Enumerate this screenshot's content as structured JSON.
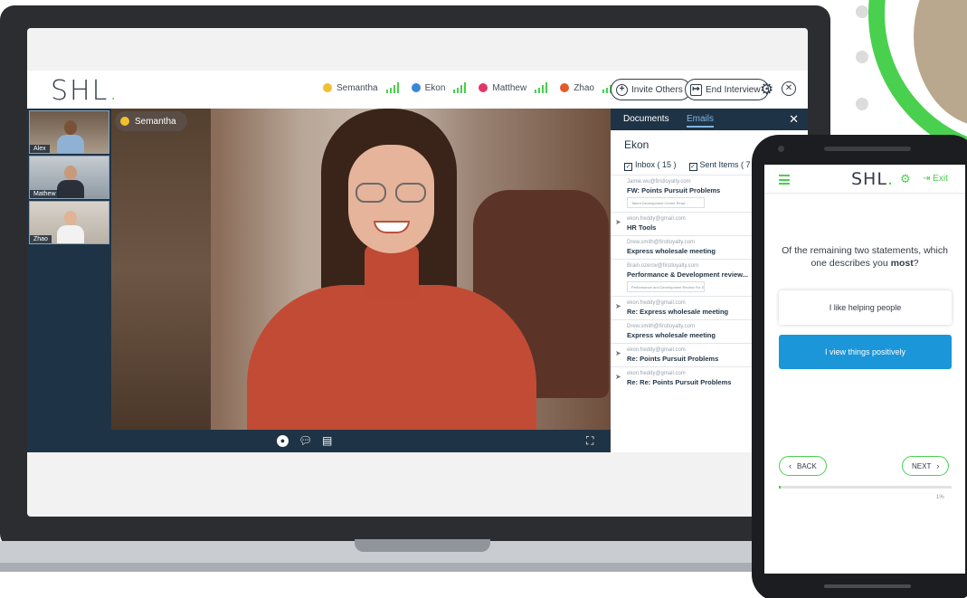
{
  "app": {
    "logo": "SHL",
    "participants": [
      {
        "name": "Semantha",
        "color": "#f0c030"
      },
      {
        "name": "Ekon",
        "color": "#3a86d8"
      },
      {
        "name": "Matthew",
        "color": "#e0386a"
      },
      {
        "name": "Zhao",
        "color": "#e55a2b"
      }
    ],
    "buttons": {
      "invite": "Invite Others",
      "end": "End Interview"
    },
    "icons": {
      "settings": "gear-icon",
      "close": "close-icon"
    }
  },
  "video": {
    "speaker": "Semantha",
    "speaker_color": "#f0c030",
    "thumbnails": [
      "Alex",
      "Mathew",
      "Zhao"
    ]
  },
  "emails": {
    "tabs": [
      "Documents",
      "Emails"
    ],
    "active_tab": "Emails",
    "owner": "Ekon",
    "folders": {
      "inbox": "Inbox ( 15 )",
      "sent": "Sent Items ( 7 )"
    },
    "items": [
      {
        "from": "Jamie.wu@firstloyalty.com",
        "subject": "FW: Points Pursuit Problems",
        "attachment": "Talent Development Centre Read...",
        "sent": false
      },
      {
        "from": "ekon.freddy@gmail.com",
        "subject": "HR Tools",
        "attachment": "",
        "sent": true
      },
      {
        "from": "Drew.smith@firstloyalty.com",
        "subject": "Express wholesale meeting",
        "attachment": "",
        "sent": false
      },
      {
        "from": "Brain.ozerov@firstloyalty.com",
        "subject": "Performance & Development review...",
        "attachment": "Performance and Development Review For E...",
        "sent": false
      },
      {
        "from": "ekon.freddy@gmail.com",
        "subject": "Re: Express wholesale meeting",
        "attachment": "",
        "sent": true
      },
      {
        "from": "Drew.smith@firstloyalty.com",
        "subject": "Express wholesale meeting",
        "attachment": "",
        "sent": false
      },
      {
        "from": "ekon.freddy@gmail.com",
        "subject": "Re: Points Pursuit Problems",
        "attachment": "",
        "sent": true
      },
      {
        "from": "ekon.freddy@gmail.com",
        "subject": "Re: Re: Points Pursuit Problems",
        "attachment": "",
        "sent": true
      }
    ]
  },
  "phone": {
    "logo": "SHL",
    "exit": "Exit",
    "question_prefix": "Of the remaining two statements, which one describes you",
    "question_emphasis": "most",
    "question_suffix": "?",
    "options": [
      {
        "label": "I like helping people",
        "selected": false
      },
      {
        "label": "I view things positively",
        "selected": true
      }
    ],
    "back": "BACK",
    "next": "NEXT",
    "progress": 1,
    "progress_label": "1%"
  },
  "colors": {
    "accent": "#49d04e",
    "navy": "#1f3346",
    "selected": "#1b96d8"
  }
}
